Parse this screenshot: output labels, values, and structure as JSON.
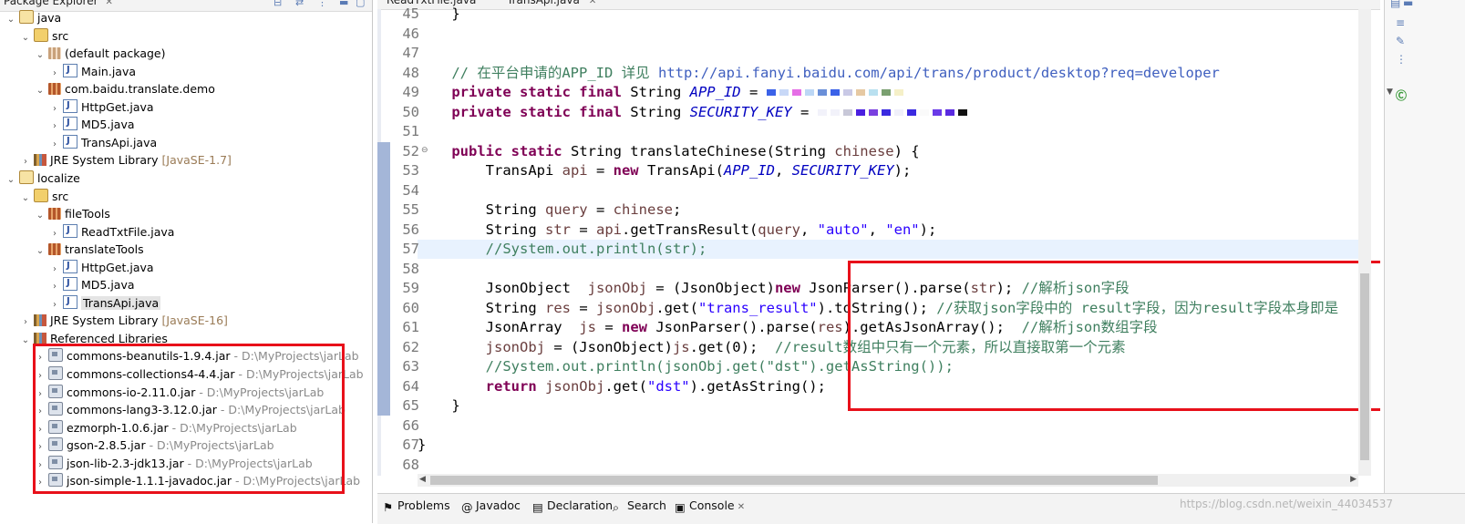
{
  "explorer": {
    "tab_label": "Package Explorer",
    "tree": [
      {
        "label": "java",
        "icon": "project-icon",
        "depth": 0,
        "toggle": "expanded"
      },
      {
        "label": "src",
        "icon": "source-folder-icon",
        "depth": 1,
        "toggle": "expanded"
      },
      {
        "label": "(default package)",
        "icon": "package-icon",
        "depth": 2,
        "toggle": "expanded"
      },
      {
        "label": "Main.java",
        "icon": "java-file-icon",
        "depth": 3,
        "toggle": "collapsed"
      },
      {
        "label": "com.baidu.translate.demo",
        "icon": "package-icon",
        "depth": 2,
        "toggle": "expanded"
      },
      {
        "label": "HttpGet.java",
        "icon": "java-file-icon",
        "depth": 3,
        "toggle": "collapsed"
      },
      {
        "label": "MD5.java",
        "icon": "java-file-icon",
        "depth": 3,
        "toggle": "collapsed"
      },
      {
        "label": "TransApi.java",
        "icon": "java-file-icon",
        "depth": 3,
        "toggle": "collapsed"
      },
      {
        "label": "JRE System Library",
        "suffix": "[JavaSE-1.7]",
        "icon": "library-icon",
        "depth": 1,
        "toggle": "collapsed"
      },
      {
        "label": "localize",
        "icon": "project-icon",
        "depth": 0,
        "toggle": "expanded"
      },
      {
        "label": "src",
        "icon": "source-folder-icon",
        "depth": 1,
        "toggle": "expanded"
      },
      {
        "label": "fileTools",
        "icon": "package-icon",
        "depth": 2,
        "toggle": "expanded"
      },
      {
        "label": "ReadTxtFile.java",
        "icon": "java-file-icon",
        "depth": 3,
        "toggle": "collapsed"
      },
      {
        "label": "translateTools",
        "icon": "package-icon",
        "depth": 2,
        "toggle": "expanded"
      },
      {
        "label": "HttpGet.java",
        "icon": "java-file-icon",
        "depth": 3,
        "toggle": "collapsed"
      },
      {
        "label": "MD5.java",
        "icon": "java-file-icon",
        "depth": 3,
        "toggle": "collapsed"
      },
      {
        "label": "TransApi.java",
        "icon": "java-file-icon",
        "depth": 3,
        "toggle": "collapsed",
        "selected": true
      },
      {
        "label": "JRE System Library",
        "suffix": "[JavaSE-16]",
        "icon": "library-icon",
        "depth": 1,
        "toggle": "collapsed"
      },
      {
        "label": "Referenced Libraries",
        "icon": "library-icon",
        "depth": 1,
        "toggle": "expanded"
      },
      {
        "label": "commons-beanutils-1.9.4.jar",
        "path": " - D:\\MyProjects\\jarLab",
        "icon": "jar-icon",
        "depth": 2,
        "toggle": "collapsed"
      },
      {
        "label": "commons-collections4-4.4.jar",
        "path": " - D:\\MyProjects\\jarLab",
        "icon": "jar-icon",
        "depth": 2,
        "toggle": "collapsed"
      },
      {
        "label": "commons-io-2.11.0.jar",
        "path": " - D:\\MyProjects\\jarLab",
        "icon": "jar-icon",
        "depth": 2,
        "toggle": "collapsed"
      },
      {
        "label": "commons-lang3-3.12.0.jar",
        "path": " - D:\\MyProjects\\jarLab",
        "icon": "jar-icon",
        "depth": 2,
        "toggle": "collapsed"
      },
      {
        "label": "ezmorph-1.0.6.jar",
        "path": " - D:\\MyProjects\\jarLab",
        "icon": "jar-icon",
        "depth": 2,
        "toggle": "collapsed"
      },
      {
        "label": "gson-2.8.5.jar",
        "path": " - D:\\MyProjects\\jarLab",
        "icon": "jar-icon",
        "depth": 2,
        "toggle": "collapsed"
      },
      {
        "label": "json-lib-2.3-jdk13.jar",
        "path": " - D:\\MyProjects\\jarLab",
        "icon": "jar-icon",
        "depth": 2,
        "toggle": "collapsed"
      },
      {
        "label": "json-simple-1.1.1-javadoc.jar",
        "path": " - D:\\MyProjects\\jarLab",
        "icon": "jar-icon",
        "depth": 2,
        "toggle": "collapsed"
      }
    ]
  },
  "editor": {
    "tabs": [
      {
        "label": "ReadTxtFile.java",
        "active": false
      },
      {
        "label": "TransApi.java",
        "active": true
      }
    ],
    "line_numbers": [
      "45",
      "46",
      "47",
      "48",
      "49",
      "50",
      "51",
      "52",
      "53",
      "54",
      "55",
      "56",
      "57",
      "58",
      "59",
      "60",
      "61",
      "62",
      "63",
      "64",
      "65",
      "66",
      "67",
      "68"
    ],
    "current_line": "57",
    "lines": [
      [
        {
          "t": "    }",
          "c": "pl"
        }
      ],
      [],
      [],
      [
        {
          "t": "    // 在平台申请的APP_ID 详见 ",
          "c": "cm"
        },
        {
          "t": "http://api.fanyi.baidu.com/api/trans/product/desktop?req=developer",
          "c": "url"
        }
      ],
      [
        {
          "t": "    private static final ",
          "c": "kw"
        },
        {
          "t": "String ",
          "c": "pl"
        },
        {
          "t": "APP_ID",
          "c": "sf"
        },
        {
          "t": " = ",
          "c": "pl"
        },
        {
          "t": "",
          "c": "blur-a"
        }
      ],
      [
        {
          "t": "    private static final ",
          "c": "kw"
        },
        {
          "t": "String ",
          "c": "pl"
        },
        {
          "t": "SECURITY_KEY",
          "c": "sf"
        },
        {
          "t": " = ",
          "c": "pl"
        },
        {
          "t": "",
          "c": "blur-b"
        }
      ],
      [],
      [
        {
          "t": "    public static ",
          "c": "kw"
        },
        {
          "t": "String translateChinese(String ",
          "c": "pl"
        },
        {
          "t": "chinese",
          "c": "vr"
        },
        {
          "t": ") {",
          "c": "pl"
        }
      ],
      [
        {
          "t": "        TransApi ",
          "c": "pl"
        },
        {
          "t": "api",
          "c": "vr"
        },
        {
          "t": " = ",
          "c": "pl"
        },
        {
          "t": "new ",
          "c": "kw"
        },
        {
          "t": "TransApi(",
          "c": "pl"
        },
        {
          "t": "APP_ID",
          "c": "sf"
        },
        {
          "t": ", ",
          "c": "pl"
        },
        {
          "t": "SECURITY_KEY",
          "c": "sf"
        },
        {
          "t": ");",
          "c": "pl"
        }
      ],
      [],
      [
        {
          "t": "        String ",
          "c": "pl"
        },
        {
          "t": "query",
          "c": "vr"
        },
        {
          "t": " = ",
          "c": "pl"
        },
        {
          "t": "chinese",
          "c": "vr"
        },
        {
          "t": ";",
          "c": "pl"
        }
      ],
      [
        {
          "t": "        String ",
          "c": "pl"
        },
        {
          "t": "str",
          "c": "vr"
        },
        {
          "t": " = ",
          "c": "pl"
        },
        {
          "t": "api",
          "c": "vr"
        },
        {
          "t": ".getTransResult(",
          "c": "pl"
        },
        {
          "t": "query",
          "c": "vr"
        },
        {
          "t": ", ",
          "c": "pl"
        },
        {
          "t": "\"auto\"",
          "c": "st"
        },
        {
          "t": ", ",
          "c": "pl"
        },
        {
          "t": "\"en\"",
          "c": "st"
        },
        {
          "t": ");",
          "c": "pl"
        }
      ],
      [
        {
          "t": "        //System.out.println(str);",
          "c": "cm"
        }
      ],
      [],
      [
        {
          "t": "        JsonObject  ",
          "c": "pl"
        },
        {
          "t": "jsonObj",
          "c": "vr"
        },
        {
          "t": " = (JsonObject)",
          "c": "pl"
        },
        {
          "t": "new ",
          "c": "kw"
        },
        {
          "t": "JsonParser().parse(",
          "c": "pl"
        },
        {
          "t": "str",
          "c": "vr"
        },
        {
          "t": "); ",
          "c": "pl"
        },
        {
          "t": "//解析json字段",
          "c": "cm"
        }
      ],
      [
        {
          "t": "        String ",
          "c": "pl"
        },
        {
          "t": "res",
          "c": "vr"
        },
        {
          "t": " = ",
          "c": "pl"
        },
        {
          "t": "jsonObj",
          "c": "vr"
        },
        {
          "t": ".get(",
          "c": "pl"
        },
        {
          "t": "\"trans_result\"",
          "c": "st"
        },
        {
          "t": ").toString(); ",
          "c": "pl"
        },
        {
          "t": "//获取json字段中的 result字段，因为result字段本身即是",
          "c": "cm"
        }
      ],
      [
        {
          "t": "        JsonArray  ",
          "c": "pl"
        },
        {
          "t": "js",
          "c": "vr"
        },
        {
          "t": " = ",
          "c": "pl"
        },
        {
          "t": "new ",
          "c": "kw"
        },
        {
          "t": "JsonParser().parse(",
          "c": "pl"
        },
        {
          "t": "res",
          "c": "vr"
        },
        {
          "t": ").getAsJsonArray();  ",
          "c": "pl"
        },
        {
          "t": "//解析json数组字段",
          "c": "cm"
        }
      ],
      [
        {
          "t": "        jsonObj",
          "c": "vr"
        },
        {
          "t": " = (JsonObject)",
          "c": "pl"
        },
        {
          "t": "js",
          "c": "vr"
        },
        {
          "t": ".get(0);  ",
          "c": "pl"
        },
        {
          "t": "//result数组中只有一个元素，所以直接取第一个元素",
          "c": "cm"
        }
      ],
      [
        {
          "t": "        //System.out.println(jsonObj.get(\"dst\").getAsString());",
          "c": "cm"
        }
      ],
      [
        {
          "t": "        return ",
          "c": "kw"
        },
        {
          "t": "jsonObj",
          "c": "vr"
        },
        {
          "t": ".get(",
          "c": "pl"
        },
        {
          "t": "\"dst\"",
          "c": "st"
        },
        {
          "t": ").getAsString();",
          "c": "pl"
        }
      ],
      [
        {
          "t": "    }",
          "c": "pl"
        }
      ],
      [],
      [
        {
          "t": "}",
          "c": "pl"
        }
      ],
      []
    ]
  },
  "bottom_tabs": [
    {
      "label": "Problems",
      "icon": "problems-icon"
    },
    {
      "label": "Javadoc",
      "icon": "at-icon"
    },
    {
      "label": "Declaration",
      "icon": "declaration-icon"
    },
    {
      "label": "Search",
      "icon": "search-icon"
    },
    {
      "label": "Console",
      "icon": "console-icon",
      "active": true
    }
  ],
  "watermark": "https://blog.csdn.net/weixin_44034537",
  "colors": {
    "keyword": "#7f0055",
    "comment": "#3f7f5f",
    "string": "#2a00ff",
    "static_field": "#0000c0",
    "local_variable": "#6a3e3e",
    "highlight_box": "#e8101a"
  }
}
